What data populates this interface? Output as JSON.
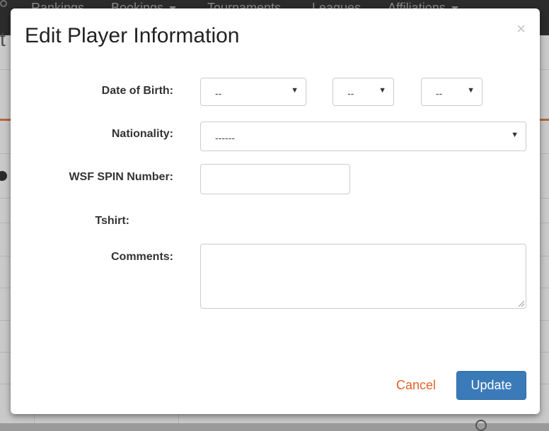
{
  "background": {
    "nav_items": [
      "Rankings",
      "Bookings",
      "Tournaments",
      "Leagues",
      "Affiliations"
    ],
    "partial_title": "t"
  },
  "modal": {
    "title": "Edit Player Information",
    "close_label": "×",
    "fields": {
      "dob": {
        "label": "Date of Birth:",
        "month": "--",
        "day": "--",
        "year": "--"
      },
      "nationality": {
        "label": "Nationality:",
        "value": "------"
      },
      "spin": {
        "label": "WSF SPIN Number:",
        "value": ""
      },
      "tshirt": {
        "label": "Tshirt:"
      },
      "comments": {
        "label": "Comments:",
        "value": ""
      }
    },
    "dropdown_arrow": "▼",
    "cancel_label": "Cancel",
    "update_label": "Update"
  },
  "colors": {
    "primary_button": "#3b7ab8",
    "cancel_link": "#e2622a",
    "overlay": "#9a9a9a"
  }
}
